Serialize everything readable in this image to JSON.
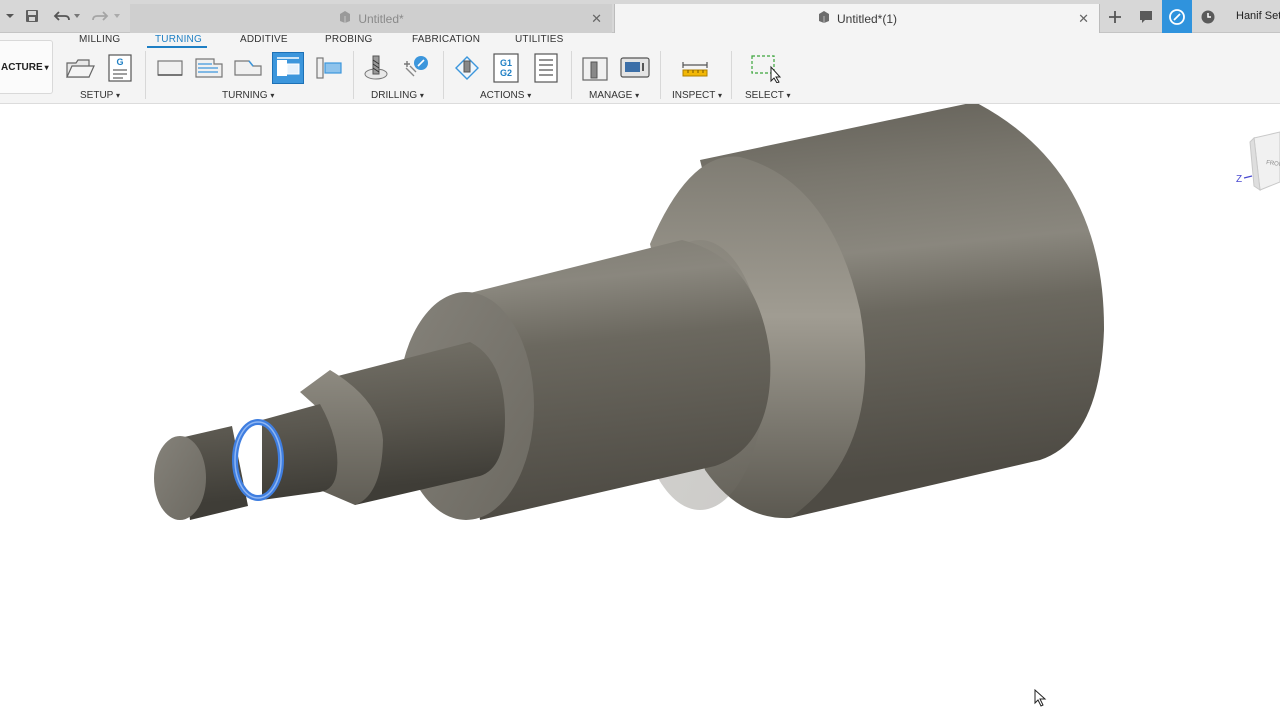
{
  "titlebar": {
    "tabs": [
      {
        "label": "Untitled*",
        "active": false
      },
      {
        "label": "Untitled*(1)",
        "active": true
      }
    ],
    "user_name": "Hanif Sety"
  },
  "ribbon": {
    "workspace_button": "ACTURE",
    "workspace_tabs": [
      "MILLING",
      "TURNING",
      "ADDITIVE",
      "PROBING",
      "FABRICATION",
      "UTILITIES"
    ],
    "active_tab": "TURNING",
    "groups": {
      "setup": "SETUP",
      "turning": "TURNING",
      "drilling": "DRILLING",
      "actions": "ACTIONS",
      "manage": "MANAGE",
      "inspect": "INSPECT",
      "select": "SELECT"
    },
    "dropdown_glyph": "▾",
    "g_code_label": "G",
    "g1g2_label_top": "G1",
    "g1g2_label_bottom": "G2"
  },
  "viewcube": {
    "face_label": "FRONT",
    "axis_label": "Z"
  },
  "colors": {
    "accent": "#1e7fc4",
    "selected_tool": "#3c96dc",
    "part_metal": "#6f6b62",
    "edge_highlight": "#3f7ee0"
  }
}
